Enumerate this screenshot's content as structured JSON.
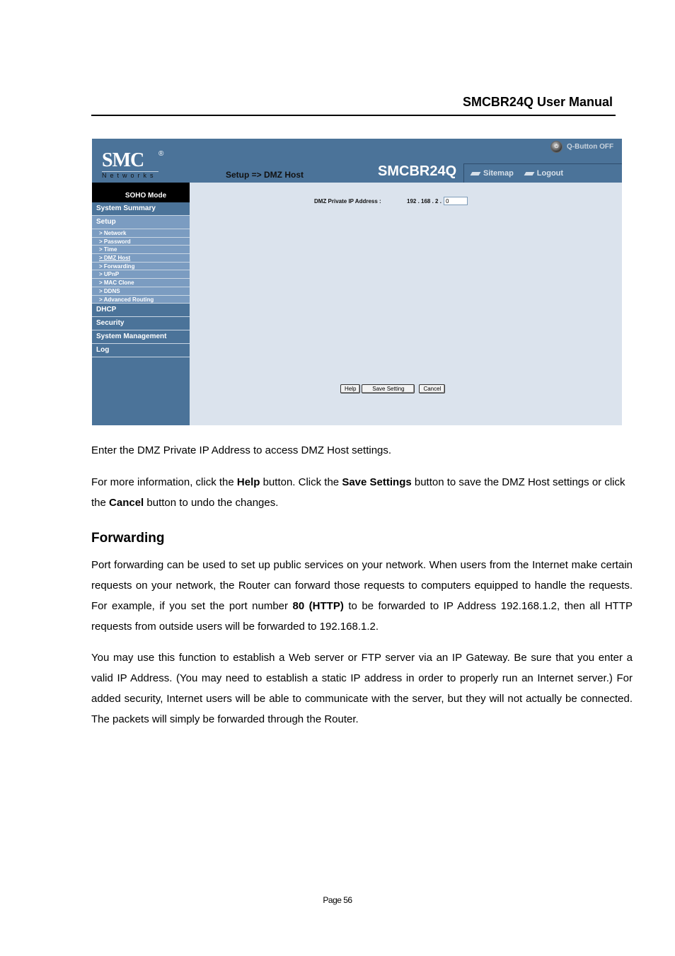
{
  "doc": {
    "header_title": "SMCBR24Q User Manual",
    "page_number": "Page 56"
  },
  "router_ui": {
    "logo_text": "SMC",
    "logo_reg": "®",
    "logo_sub": "Networks",
    "breadcrumb": "Setup => DMZ Host",
    "model": "SMCBR24Q",
    "q_button": "Q-Button OFF",
    "topnav": [
      {
        "label": "Sitemap",
        "icon": "sitemap-icon"
      },
      {
        "label": "Logout",
        "icon": "logout-icon"
      }
    ],
    "sidebar": {
      "mode": "SOHO Mode",
      "items": [
        {
          "label": "System Summary"
        },
        {
          "label": "Setup"
        },
        {
          "label": "DHCP"
        },
        {
          "label": "Security"
        },
        {
          "label": "System Management"
        },
        {
          "label": "Log"
        }
      ],
      "setup_sub": [
        "> Network",
        "> Password",
        "> Time",
        "> DMZ Host",
        "> Forwarding",
        "> UPnP",
        "> MAC Clone",
        "> DDNS",
        "> Advanced Routing"
      ],
      "active_sub": "> DMZ Host"
    },
    "form": {
      "dmz_label": "DMZ Private IP Address :",
      "ip_prefix": "192 . 168 . 2 .",
      "ip_last_octet": "0"
    },
    "buttons": {
      "help": "Help",
      "save": "Save Setting",
      "cancel": "Cancel"
    },
    "colors": {
      "banner": "#4b7399",
      "content_bg": "#dbe3ed",
      "setup_highlight": "#7b9cc1"
    }
  },
  "body": {
    "p1": "Enter the DMZ Private IP Address to access DMZ Host settings.",
    "p2_parts": [
      "For more information, click the ",
      "Help",
      " button. Click the ",
      "Save Settings",
      " button to save the DMZ Host settings or click the ",
      "Cancel",
      " button to undo the changes."
    ],
    "heading": "Forwarding",
    "p3_parts": [
      "Port forwarding can be used to set up public services on your network. When users from the Internet make certain requests on your network, the Router can forward those requests to computers equipped to handle the requests. For example, if you set the port number ",
      "80 (HTTP)",
      " to be forwarded to IP Address 192.168.1.2, then all HTTP requests from outside users will be forwarded to 192.168.1.2."
    ],
    "p4": "You may use this function to establish a Web server or FTP server via an IP Gateway. Be sure that you enter a valid IP Address. (You may need to establish a static IP address in order to properly run an Internet server.) For added security, Internet users will be able to communicate with the server, but they will not actually be connected. The packets will simply be forwarded through the Router."
  }
}
